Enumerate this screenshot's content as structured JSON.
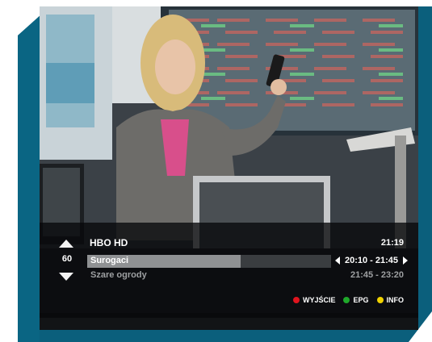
{
  "channel": {
    "number": "60",
    "name": "HBO HD"
  },
  "clock": "21:19",
  "now": {
    "title": "Surogaci",
    "time": "20:10 - 21:45",
    "progress_fraction": 0.63
  },
  "next": {
    "title": "Szare ogrody",
    "time": "21:45 - 23:20"
  },
  "keys": [
    {
      "label": "WYJŚCIE",
      "color": "#e0141e"
    },
    {
      "label": "EPG",
      "color": "#1fa82a"
    },
    {
      "label": "INFO",
      "color": "#f0d200"
    }
  ],
  "colors": {
    "frame": "#0b5f7c",
    "frame_dark": "#084a61"
  },
  "icons": {
    "channel_up": "arrow-up-icon",
    "channel_down": "arrow-down-icon",
    "prev": "triangle-left-icon",
    "next": "triangle-right-icon"
  }
}
